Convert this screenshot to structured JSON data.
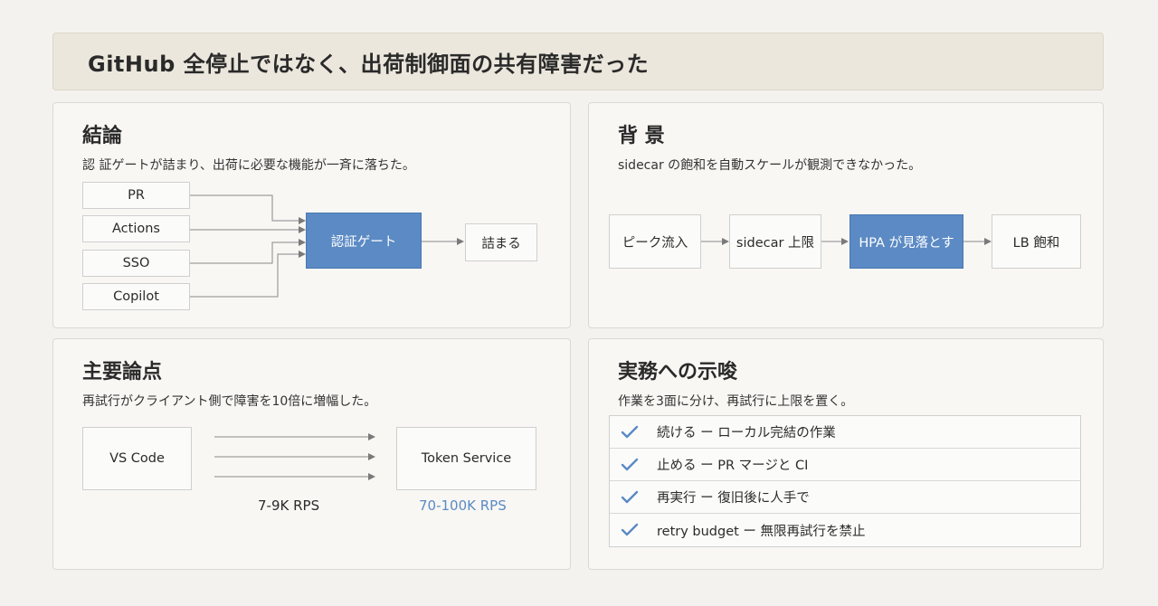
{
  "title": "GitHub 全停止ではなく、出荷制御面の共有障害だった",
  "conclusion": {
    "heading": "結論",
    "subtitle": "認 証ゲートが詰まり、出荷に必要な機能が一斉に落ちた。",
    "sources": [
      "PR",
      "Actions",
      "SSO",
      "Copilot"
    ],
    "gate": "認証ゲート",
    "result": "詰まる"
  },
  "background": {
    "heading": "背 景",
    "subtitle": "sidecar の飽和を自動スケールが観測できなかった。",
    "flow": [
      "ピーク流入",
      "sidecar 上限",
      "HPA が見落とす",
      "LB 飽和"
    ]
  },
  "issue": {
    "heading": "主要論点",
    "subtitle": "再試行がクライアント側で障害を10倍に増幅した。",
    "client": "VS Code",
    "server": "Token Service",
    "rate_before": "7-9K RPS",
    "rate_after": "70-100K RPS"
  },
  "implications": {
    "heading": "実務への示唆",
    "subtitle": "作業を3面に分け、再試行に上限を置く。",
    "items": [
      "続ける ー ローカル完結の作業",
      "止める ー PR マージと CI",
      "再実行 ー 復旧後に人手で",
      "retry budget ー 無限再試行を禁止"
    ]
  },
  "colors": {
    "accent": "#5b8ac4",
    "arrow": "#8a8a8a"
  }
}
